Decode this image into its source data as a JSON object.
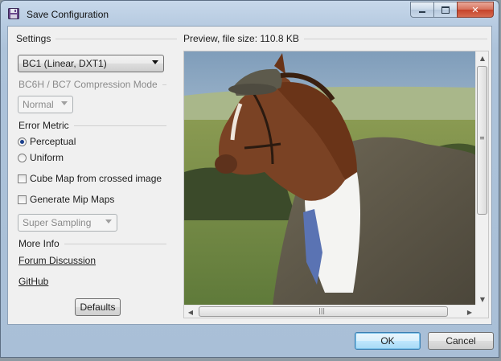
{
  "window": {
    "title": "Save Configuration",
    "minimize_icon": "minimize-icon",
    "maximize_icon": "maximize-icon",
    "close_icon": "close-icon",
    "app_icon": "floppy-disk-icon"
  },
  "settings": {
    "header": "Settings",
    "format_select": {
      "value": "BC1 (Linear, DXT1)"
    },
    "compression_mode": {
      "header": "BC6H / BC7 Compression Mode",
      "select_value": "Normal"
    },
    "error_metric": {
      "header": "Error Metric",
      "options": [
        {
          "label": "Perceptual",
          "checked": true
        },
        {
          "label": "Uniform",
          "checked": false
        }
      ]
    },
    "cube_map_label": "Cube Map from crossed image",
    "mip_maps_label": "Generate Mip Maps",
    "sampling_select": {
      "value": "Super Sampling"
    },
    "more_info": {
      "header": "More Info",
      "forum_link": "Forum Discussion",
      "github_link": "GitHub"
    },
    "defaults_button": "Defaults"
  },
  "preview": {
    "header": "Preview, file size: 110.8 KB",
    "image_icon": "horse-in-suit-image"
  },
  "footer": {
    "ok_button": "OK",
    "cancel_button": "Cancel"
  },
  "colors": {
    "accent": "#3c7fb1",
    "title_bar": "#b7cbe1",
    "close_button": "#c5432a"
  }
}
